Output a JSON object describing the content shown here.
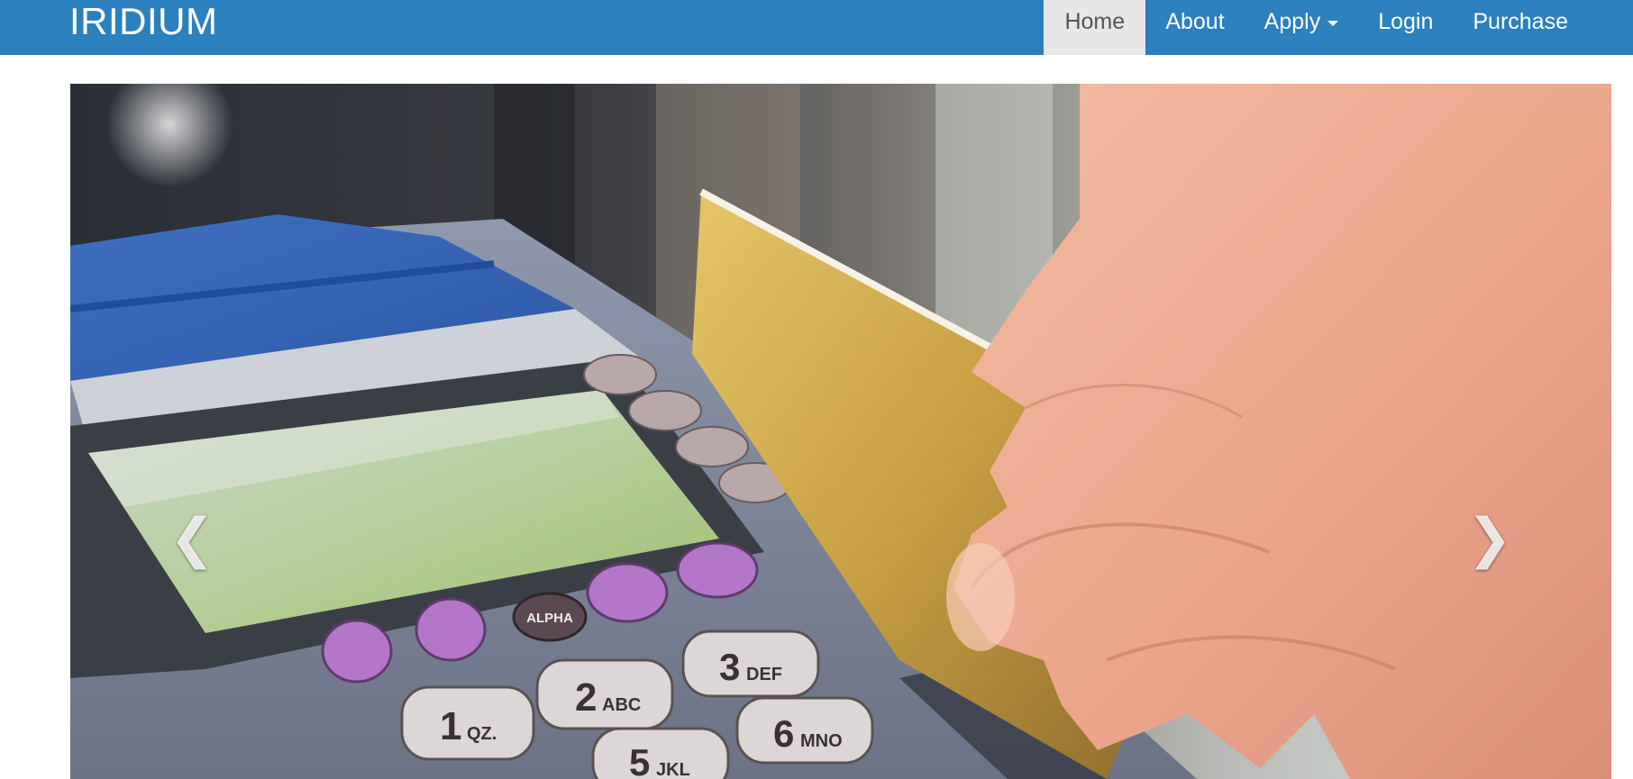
{
  "navbar": {
    "brand": "IRIDIUM",
    "items": [
      {
        "label": "Home",
        "active": true
      },
      {
        "label": "About"
      },
      {
        "label": "Apply",
        "dropdown": true
      },
      {
        "label": "Login"
      },
      {
        "label": "Purchase"
      }
    ]
  },
  "carousel": {
    "image_subject": "hand swiping a gold credit card through a card payment terminal",
    "prev_icon": "chevron-left-icon",
    "next_icon": "chevron-right-icon",
    "prev_glyph": "❮",
    "next_glyph": "❯",
    "keypad": {
      "alpha": "ALPHA",
      "keys": [
        {
          "num": "1",
          "letters": "QZ."
        },
        {
          "num": "2",
          "letters": "ABC"
        },
        {
          "num": "3",
          "letters": "DEF"
        },
        {
          "num": "5",
          "letters": "JKL"
        },
        {
          "num": "6",
          "letters": "MNO"
        }
      ]
    }
  },
  "colors": {
    "navbar_bg": "#2b80bd",
    "active_tab_bg": "#e7e7e7",
    "active_tab_text": "#555555"
  }
}
